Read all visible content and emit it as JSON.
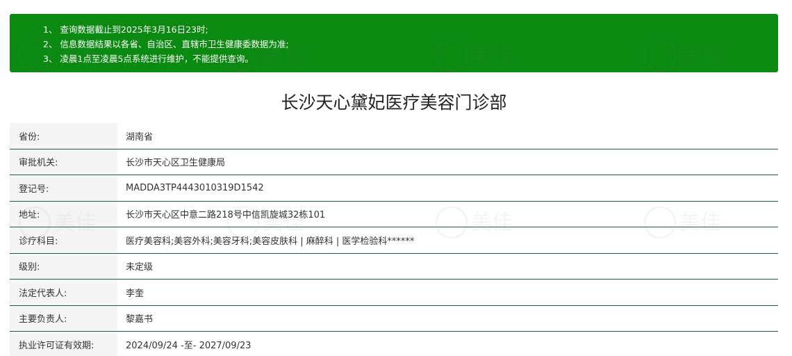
{
  "notice": {
    "lines": [
      "1、 查询数据截止到2025年3月16日23时;",
      "2、 信息数据结果以各省、自治区、直辖市卫生健康委数据为准;",
      "3、 凌晨1点至凌晨5点系统进行维护，不能提供查询。"
    ]
  },
  "title": "长沙天心黛妃医疗美容门诊部",
  "rows": [
    {
      "label": "省份:",
      "value": "湖南省"
    },
    {
      "label": "审批机关:",
      "value": "长沙市天心区卫生健康局"
    },
    {
      "label": "登记号:",
      "value": "MADDA3TP4443010319D1542"
    },
    {
      "label": "地址:",
      "value": "长沙市天心区中意二路218号中信凯旋城32栋101"
    },
    {
      "label": "诊疗科目:",
      "value": "医疗美容科;美容外科;美容牙科;美容皮肤科 | 麻醉科 | 医学检验科******"
    },
    {
      "label": "级别:",
      "value": "未定级"
    },
    {
      "label": "法定代表人:",
      "value": "李奎"
    },
    {
      "label": "主要负责人:",
      "value": "黎嘉书"
    },
    {
      "label": "执业许可证有效期:",
      "value": "2024/09/24 -至- 2027/09/23"
    }
  ],
  "watermark": {
    "text": "美佳",
    "domain": "236z.com"
  },
  "colors": {
    "notice_bg": "#0a8a10",
    "row_border": "#1e5a42",
    "label_bg": "#f5f5f5"
  }
}
